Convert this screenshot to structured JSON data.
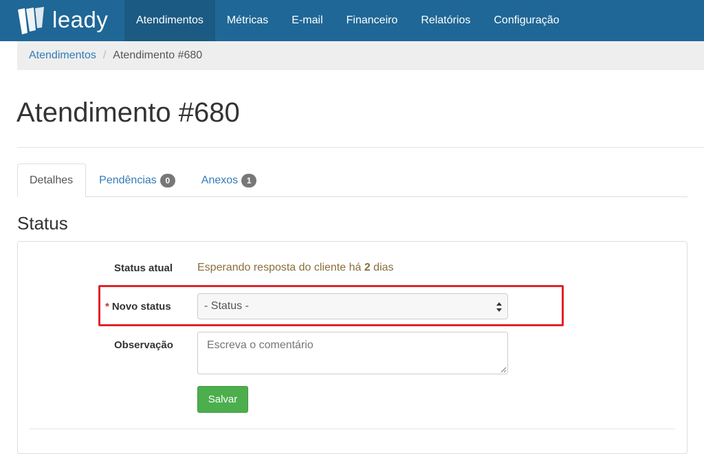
{
  "brand": {
    "name": "leady",
    "logo_icon": "leady-logo-icon",
    "nav_color": "#1f6796"
  },
  "nav": {
    "items": [
      {
        "label": "Atendimentos",
        "active": true
      },
      {
        "label": "Métricas"
      },
      {
        "label": "E-mail"
      },
      {
        "label": "Financeiro"
      },
      {
        "label": "Relatórios"
      },
      {
        "label": "Configuração"
      }
    ]
  },
  "breadcrumb": {
    "parent": "Atendimentos",
    "separator": "/",
    "current": "Atendimento #680"
  },
  "page": {
    "title": "Atendimento #680"
  },
  "tabs": [
    {
      "label": "Detalhes",
      "active": true
    },
    {
      "label": "Pendências",
      "badge": "0"
    },
    {
      "label": "Anexos",
      "badge": "1"
    }
  ],
  "section": {
    "title": "Status"
  },
  "form": {
    "current_status_label": "Status atual",
    "current_status_prefix": "Esperando resposta do cliente há ",
    "current_status_days": "2",
    "current_status_suffix": " dias",
    "required_marker": "*",
    "new_status_label": "Novo status",
    "new_status_selected": "- Status -",
    "note_label": "Observação",
    "note_placeholder": "Escreva o comentário",
    "save_label": "Salvar",
    "save_color": "#4cae4c",
    "highlight_color": "#e0232a"
  }
}
